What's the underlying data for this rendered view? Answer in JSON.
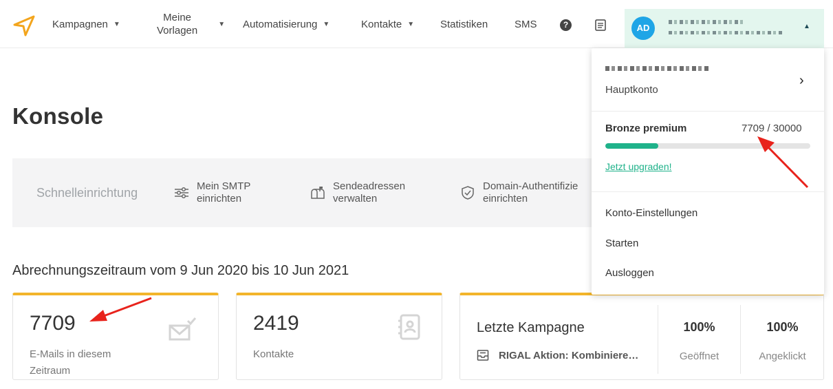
{
  "nav": {
    "campaigns": "Kampagnen",
    "templates_line1": "Meine",
    "templates_line2": "Vorlagen",
    "automation": "Automatisierung",
    "contacts": "Kontakte",
    "statistics": "Statistiken",
    "sms": "SMS",
    "help_glyph": "?",
    "avatar_initials": "AD"
  },
  "page": {
    "title": "Konsole",
    "period": "Abrechnungszeitraum vom 9 Jun 2020 bis 10 Jun 2021"
  },
  "quick_setup": {
    "label": "Schnelleinrichtung",
    "items": [
      {
        "line1": "Mein SMTP",
        "line2": "einrichten"
      },
      {
        "line1": "Sendeadressen",
        "line2": "verwalten"
      },
      {
        "line1": "Domain-Authentifizie",
        "line2": "einrichten"
      }
    ]
  },
  "cards": {
    "emails": {
      "value": "7709",
      "label_line1": "E-Mails in diesem",
      "label_line2": "Zeitraum"
    },
    "contacts": {
      "value": "2419",
      "label": "Kontakte"
    },
    "last_campaign": {
      "title": "Letzte Kampagne",
      "name": "RIGAL Aktion: Kombiniere…",
      "opened_value": "100%",
      "opened_label": "Geöffnet",
      "clicked_value": "100%",
      "clicked_label": "Angeklickt"
    }
  },
  "account_menu": {
    "account_type": "Hauptkonto",
    "plan_name": "Bronze premium",
    "plan_usage": "7709 / 30000",
    "plan_used_fraction": 0.257,
    "upgrade_link": "Jetzt upgraden!",
    "items": [
      "Konto-Einstellungen",
      "Starten",
      "Ausloggen"
    ]
  },
  "colors": {
    "accent_orange": "#f3b52a",
    "accent_green": "#1fb28a",
    "avatar_blue": "#1fa5e6",
    "annotation_red": "#e8231c"
  }
}
